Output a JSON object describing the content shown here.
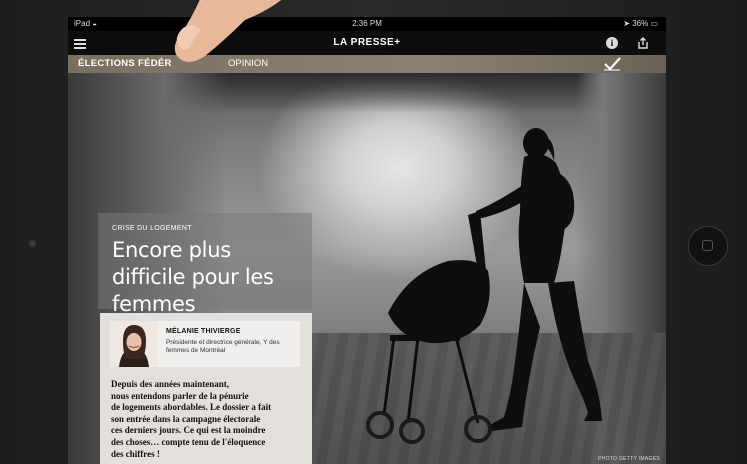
{
  "status_bar": {
    "device": "iPad",
    "wifi_icon": "wifi-icon",
    "time": "2:36 PM",
    "battery": "36%"
  },
  "nav": {
    "menu_icon": "menu-icon",
    "brand": "LA PRESSE+",
    "info_icon": "info-icon",
    "share_icon": "share-icon"
  },
  "section_bar": {
    "primary": "ÉLECTIONS FÉDÉR",
    "secondary": "OPINION",
    "badge_icon": "checkmark-badge-icon"
  },
  "article": {
    "kicker": "CRISE DU LOGEMENT",
    "headline": "Encore plus difficile pour les femmes",
    "author": {
      "name": "MÉLANIE THIVIERGE",
      "role": "Présidente et directrice générale, Y des femmes de Montréal"
    },
    "lead": "Depuis des années maintenant,\nnous entendons parler de la pénurie\nde logements abordables. Le dossier a fait\nson entrée dans la campagne électorale\nces derniers jours. Ce qui est la moindre\ndes choses… compte tenu de l'éloquence\ndes chiffres !",
    "photo_credit": "PHOTO GETTY IMAGES"
  },
  "colors": {
    "section_bar": "#8c8174",
    "nav_bg": "#0d0d0d",
    "card_bg": "#e3e0dc"
  }
}
